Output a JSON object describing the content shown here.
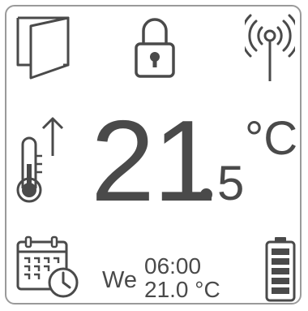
{
  "display": {
    "icons": {
      "window": "window-open-icon",
      "lock": "lock-icon",
      "signal": "wireless-signal-icon",
      "heating": "thermometer-rising-icon",
      "schedule": "calendar-clock-icon",
      "battery": "battery-full-icon"
    },
    "temperature": {
      "whole": "21",
      "decimal": "5",
      "unit": "°C"
    },
    "schedule": {
      "day": "We",
      "time": "06:00",
      "temperature": "21.0 °C"
    },
    "colors": {
      "foreground": "#4a4a4a",
      "frame": "#9a9a9a",
      "background": "#ffffff"
    }
  }
}
